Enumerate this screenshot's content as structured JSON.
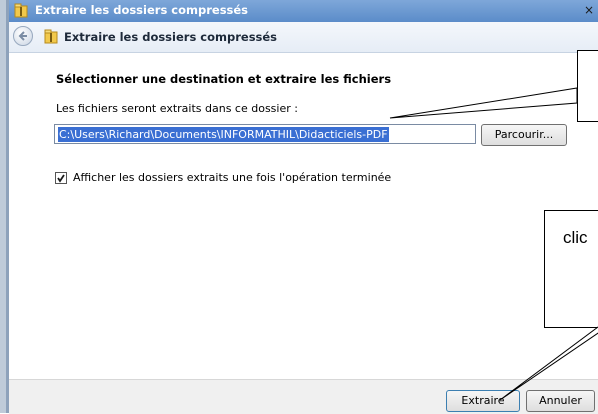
{
  "window": {
    "title": "Extraire les dossiers compressés",
    "close_glyph": "×"
  },
  "nav": {
    "back_icon": "back-arrow-icon",
    "title": "Extraire les dossiers compressés"
  },
  "main": {
    "heading": "Sélectionner une destination et extraire les fichiers",
    "path_label": "Les fichiers seront extraits dans ce dossier :",
    "path_value": "C:\\Users\\Richard\\Documents\\INFORMATHIL\\Didacticiels-PDF",
    "browse_label": "Parcourir...",
    "show_checkbox_checked": true,
    "show_label": "Afficher les dossiers extraits une fois l'opération terminée"
  },
  "footer": {
    "extract_label": "Extraire",
    "cancel_label": "Annuler"
  },
  "annotation": {
    "callout_text": "clic"
  }
}
